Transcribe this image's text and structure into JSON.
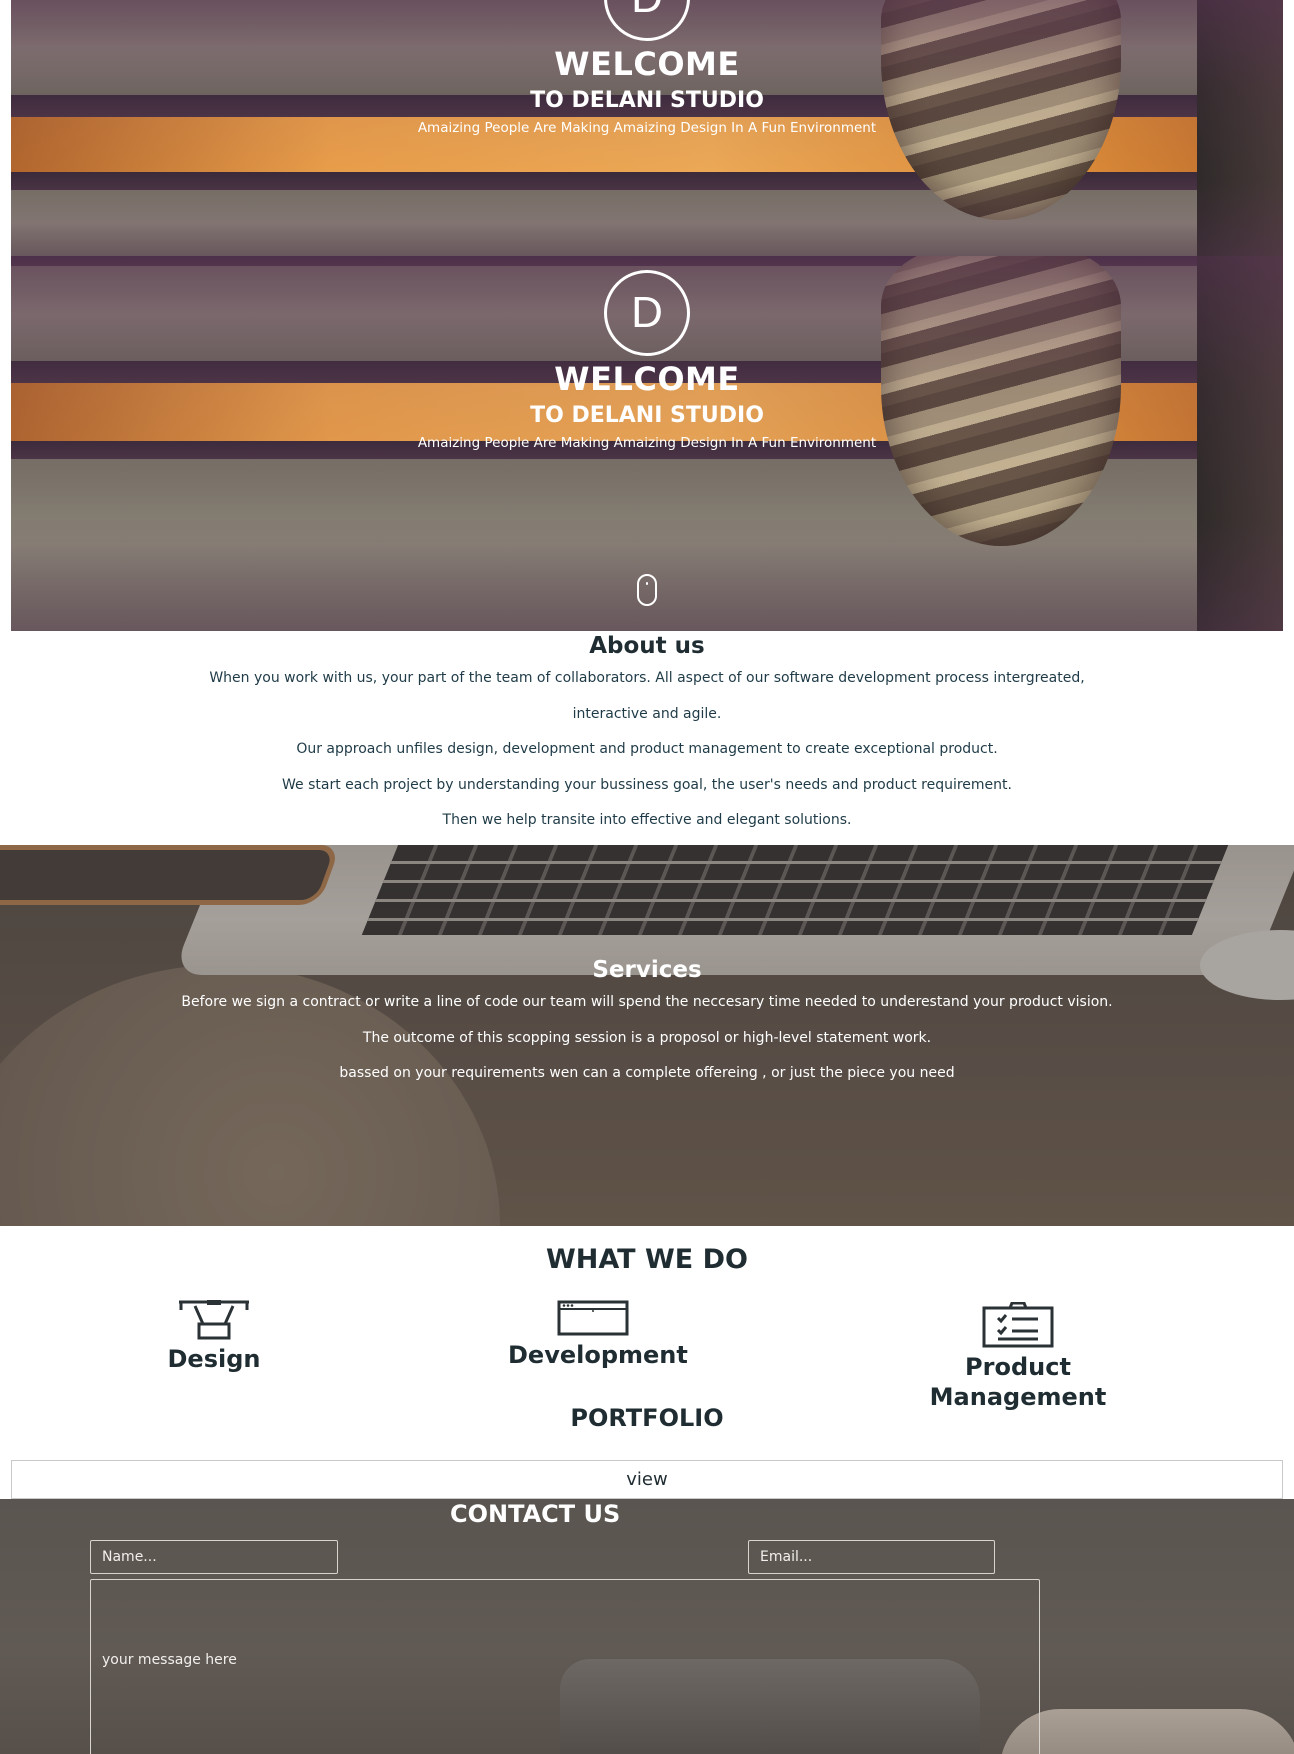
{
  "hero": {
    "logo_letter": "D",
    "welcome": "WELCOME",
    "studio": "TO DELANI STUDIO",
    "tagline": "Amaizing People Are Making Amaizing Design In A Fun Environment"
  },
  "about": {
    "title": "About us",
    "paragraphs": [
      "When you work with us, your part of the team of collaborators. All aspect of our software development process intergreated, interactive and agile.",
      "Our approach unfiles design, development and product management to create exceptional product.",
      "We start each project by understanding your bussiness goal, the user's needs and product requirement.",
      "Then we help transite into effective and elegant solutions."
    ]
  },
  "services": {
    "title": "Services",
    "paragraphs": [
      "Before we sign a contract or write a line of code our team will spend the neccesary time needed to underestand your product vision.",
      "The outcome of this scopping session is a proposol or high-level statement work.",
      "bassed on your requirements wen can a complete offereing , or just the piece you need"
    ]
  },
  "what_we_do": {
    "title": "WHAT WE DO",
    "items": [
      {
        "label": "Design",
        "icon": "drone-icon"
      },
      {
        "label": "Development",
        "icon": "browser-window-icon"
      },
      {
        "label": "Product Management",
        "icon": "clipboard-checklist-icon"
      }
    ]
  },
  "portfolio": {
    "title": "PORTFOLIO",
    "view_label": "view"
  },
  "contact": {
    "title": "CONTACT US",
    "name_placeholder": "Name...",
    "email_placeholder": "Email...",
    "message_placeholder": "your message here"
  },
  "colors": {
    "accent_orange": "#f2a44a",
    "text_dark": "#1f2d32",
    "white": "#ffffff"
  }
}
